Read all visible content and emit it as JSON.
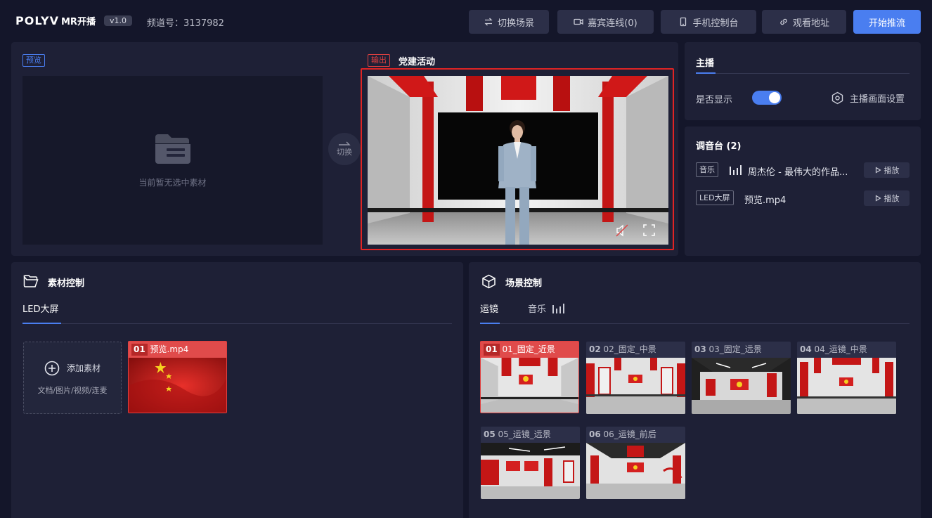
{
  "topbar": {
    "logo": "POLYV",
    "logo_suffix": "MR开播",
    "version": "v1.0",
    "channel": "频道号：3137982",
    "buttons": {
      "switch_scene": "切换场景",
      "guest_connect": "嘉宾连线(0)",
      "mobile_console": "手机控制台",
      "watch_url": "观看地址",
      "start_stream": "开始推流"
    }
  },
  "preview": {
    "tag": "预览",
    "empty_message": "当前暂无选中素材",
    "switch_label": "切换"
  },
  "output": {
    "tag": "输出",
    "title": "党建活动"
  },
  "host": {
    "title": "主播",
    "show_label": "是否显示",
    "show_enabled": true,
    "settings_label": "主播画面设置"
  },
  "mixer": {
    "title": "调音台 (2)",
    "items": [
      {
        "type": "音乐",
        "name": "周杰伦 - 最伟大的作品...",
        "action": "播放"
      },
      {
        "type": "LED大屏",
        "name": "预览.mp4",
        "action": "播放"
      }
    ]
  },
  "material": {
    "title": "素材控制",
    "tab": "LED大屏",
    "add_label": "添加素材",
    "add_hint": "文档/图片/视频/连麦",
    "items": [
      {
        "num": "01",
        "name": "预览.mp4",
        "active": true
      }
    ]
  },
  "scene": {
    "title": "场景控制",
    "tabs": [
      "运镜",
      "音乐"
    ],
    "items": [
      {
        "num": "01",
        "name": "01_固定_近景",
        "active": true
      },
      {
        "num": "02",
        "name": "02_固定_中景",
        "active": false
      },
      {
        "num": "03",
        "name": "03_固定_远景",
        "active": false
      },
      {
        "num": "04",
        "name": "04_运镜_中景",
        "active": false
      },
      {
        "num": "05",
        "name": "05_运镜_远景",
        "active": false
      },
      {
        "num": "06",
        "name": "06_运镜_前后",
        "active": false
      }
    ]
  },
  "colors": {
    "accent": "#4a7ef0",
    "danger": "#e04040",
    "panel": "#1e2036",
    "background": "#14162a"
  }
}
